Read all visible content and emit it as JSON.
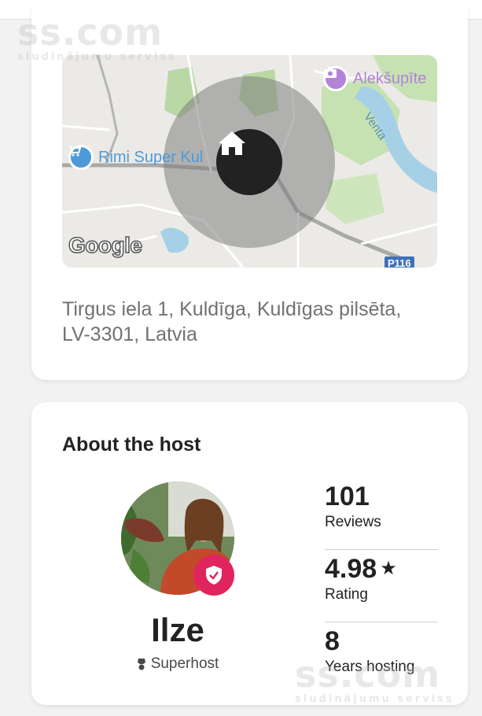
{
  "watermark": {
    "brand": "ss.com",
    "tagline": "sludinājumu serviss"
  },
  "map": {
    "poi_shop": "Rimi Super Kul",
    "poi_photo": "Alekšupīte",
    "river": "Venta",
    "logo": "Google",
    "road": "P116",
    "shop_icon": "cart-icon",
    "photo_icon": "camera-icon",
    "home_icon": "home-icon"
  },
  "location": {
    "address": "Tirgus iela 1, Kuldīga, Kuldīgas pilsēta, LV-3301, Latvia"
  },
  "host": {
    "section_title": "About the host",
    "name": "Ilze",
    "badge_label": "Superhost",
    "badge_color": "#e0245e",
    "stats": [
      {
        "value": "101",
        "label": "Reviews"
      },
      {
        "value": "4.98",
        "label": "Rating"
      },
      {
        "value": "8",
        "label": "Years hosting"
      }
    ]
  }
}
